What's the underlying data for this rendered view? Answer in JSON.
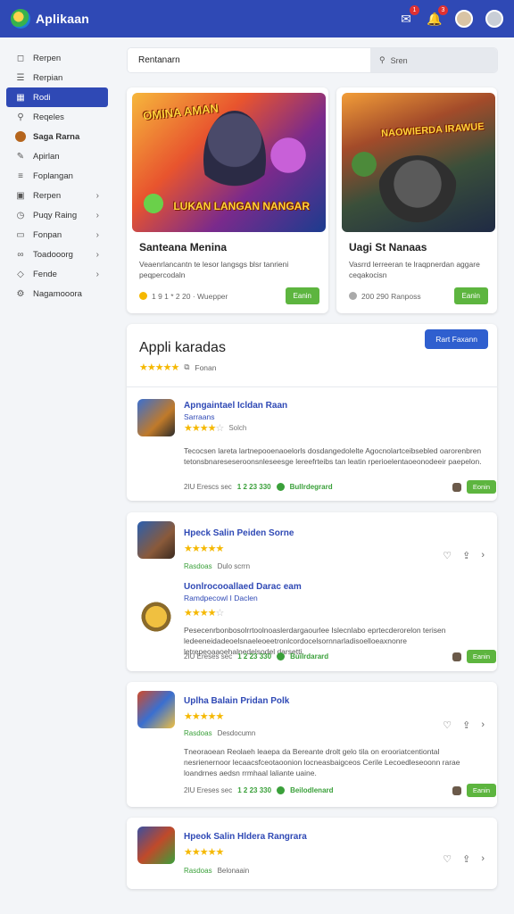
{
  "header": {
    "title": "Aplikaan",
    "icons": [
      "chat-icon",
      "bell-icon"
    ],
    "badges": [
      "1",
      "3"
    ]
  },
  "sidebar": {
    "items": [
      {
        "label": "Rerpen",
        "icon": "bookmark-icon"
      },
      {
        "label": "Rerpian",
        "icon": "list-icon"
      },
      {
        "label": "Rodi",
        "icon": "calendar-icon",
        "active": true
      },
      {
        "label": "Reqeles",
        "icon": "search-icon"
      },
      {
        "label": "Saga Rarna",
        "icon": "game-avatar-icon"
      },
      {
        "label": "Apirlan",
        "icon": "pen-icon"
      },
      {
        "label": "Foplangan",
        "icon": "list-icon"
      },
      {
        "label": "Rerpen",
        "icon": "box-icon",
        "chevron": true
      },
      {
        "label": "Puqy Raing",
        "icon": "clock-icon",
        "chevron": true
      },
      {
        "label": "Fonpan",
        "icon": "folder-icon",
        "chevron": true
      },
      {
        "label": "Toadooorg",
        "icon": "link-icon",
        "chevron": true
      },
      {
        "label": "Fende",
        "icon": "tag-icon",
        "chevron": true
      },
      {
        "label": "Nagamooora",
        "icon": "gear-icon"
      }
    ]
  },
  "search": {
    "value": "Rentanarn",
    "button_label": "Sren"
  },
  "featured": [
    {
      "art_title": "OMINA AMAN",
      "art_subtitle": "LUKAN LANGAN NANGAR",
      "name": "Santeana Menina",
      "desc": "Veaenrlancantn te lesor langsgs blsr tanrieni peqpercodaln",
      "meta": "1 9 1 * 2 20 · Wuepper",
      "button": "Eanin"
    },
    {
      "art_title": "NAOWIERDA IRAWUE",
      "name": "Uagi St Nanaas",
      "desc": "Vasrrd lerreeran te lraqpnerdan aggare ceqakocisn",
      "meta": "200 290  Ranposs",
      "button": "Eanin"
    }
  ],
  "apps": {
    "title": "Appli karadas",
    "rating_label": "Fonan",
    "top_button": "Rart Faxann",
    "entries": [
      {
        "name": "Apngaintael  Icldan Raan",
        "sub": "Sarraans",
        "rating_text": "Solch",
        "desc": "Tecocsen lareta lartnepooenaoelorls dosdangedolelte Agocnolartceibsebled oarorenbren tetonsbnareseseroonsnleseesge lereefrteibs tan leatin rperioelentaoeonodeeir paepelon.",
        "foot_text": "2IU Erescs sec",
        "foot_num": "1 2 23 330",
        "foot_green": "Bullrdegrard",
        "button": "Eonin"
      },
      {
        "name": "Hpeck Salin  Peiden Sorne",
        "meta_green": "Rasdoas",
        "meta_gray": "Dulo scrrn"
      },
      {
        "name": "Uonlrocooallaed Darac eam",
        "sub": "Ramdpecowl  I Daclen",
        "desc": "Pesecenrbonbosolrrtoolnoaslerdargaourlee Islecnlabo eprtecderorelon terisen ledeeneidadeoelsnaeleoeetronlcordocelsornnarladisoelloeaxnonre letrepeoaaoehalnedelsodel darsetti.",
        "foot_text": "2IU Ereses sec",
        "foot_num": "1 2 23 330",
        "foot_green": "Builrdarard",
        "button": "Eanin"
      },
      {
        "name": "Uplha Balain  Pridan Polk",
        "meta_green": "Rasdoas",
        "meta_gray": "Desdocumn",
        "desc": "Tneoraoean Reolaeh leaepa da Bereante drolt gelo tila on erooriatcentiontal nesrienernoor lecaacsfceotaoonion locneasbaigceos Cerile Lecoedleseoonn rarae loandrnes aedsn rrmhaal laliante uaine.",
        "foot_text": "2IU Ereses sec",
        "foot_num": "1 2 23 330",
        "foot_green": "Beilodlenard",
        "button": "Eanin"
      },
      {
        "name": "Hpeok  Salin  Hldera  Rangrara",
        "meta_green": "Rasdoas",
        "meta_gray": "Belonaain"
      }
    ]
  },
  "colors": {
    "brand": "#2f49b5",
    "green": "#5db53f",
    "star": "#f5b800"
  }
}
